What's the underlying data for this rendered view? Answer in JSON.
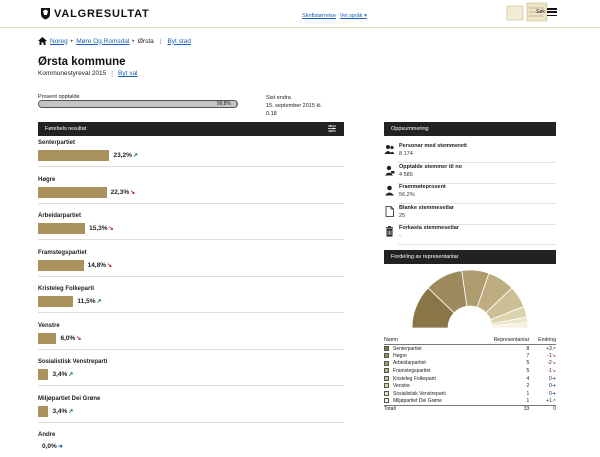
{
  "header": {
    "brand": "VALGRESULTAT",
    "links": [
      "Skriftstørrelse",
      "Vel språk"
    ],
    "menu_label": "Søk"
  },
  "breadcrumb": {
    "items": [
      "Noreg",
      "Møre Og Romsdal",
      "Ørsta"
    ],
    "change_place": "Byt stad"
  },
  "page": {
    "title": "Ørsta kommune",
    "election": "Kommunestyreval 2015",
    "change_election": "Byt val"
  },
  "counted": {
    "label": "Prosent opptalde",
    "percent_text": "99,8%",
    "value": 99.8
  },
  "last_changed": {
    "label": "Sist endra",
    "value_line1": "15. september 2015 kl.",
    "value_line2": "0.18"
  },
  "results": {
    "heading": "Førebels resultat",
    "parties": [
      {
        "name": "Senterpartiet",
        "value": 23.2,
        "text": "23,2%",
        "trend": "up"
      },
      {
        "name": "Høgre",
        "value": 22.3,
        "text": "22,3%",
        "trend": "down"
      },
      {
        "name": "Arbeidarpartiet",
        "value": 15.3,
        "text": "15,3%",
        "trend": "down"
      },
      {
        "name": "Framstegspartiet",
        "value": 14.8,
        "text": "14,8%",
        "trend": "down"
      },
      {
        "name": "Kristeleg Folkeparti",
        "value": 11.5,
        "text": "11,5%",
        "trend": "up"
      },
      {
        "name": "Venstre",
        "value": 6.0,
        "text": "6,0%",
        "trend": "down"
      },
      {
        "name": "Sosialistisk Venstreparti",
        "value": 3.4,
        "text": "3,4%",
        "trend": "up"
      },
      {
        "name": "Miljøpartiet Dei Grøne",
        "value": 3.4,
        "text": "3,4%",
        "trend": "up"
      },
      {
        "name": "Andre",
        "value": 0.0,
        "text": "0,0%",
        "trend": "same"
      }
    ]
  },
  "summary": {
    "heading": "Oppsummering",
    "items": [
      {
        "label": "Personar med stemmerett",
        "value": "8 174",
        "icon": "people-icon"
      },
      {
        "label": "Opptalde stemmer til no",
        "value": "4 585",
        "icon": "person-vote-icon"
      },
      {
        "label": "Frammøteprosent",
        "value": "56,2%",
        "icon": "person-icon"
      },
      {
        "label": "Blanke stemmesetlar",
        "value": "25",
        "icon": "blank-ballot-icon"
      },
      {
        "label": "Forkasta stemmesetlar",
        "value": "-",
        "icon": "trash-icon"
      }
    ]
  },
  "distribution": {
    "heading": "Fordeling av representantar",
    "columns": [
      "Namn",
      "Representantar",
      "Endring"
    ],
    "rows": [
      {
        "name": "Senterpartiet",
        "seats": "8",
        "change": "+3",
        "trend": "up",
        "color": "#8a7546"
      },
      {
        "name": "Høgre",
        "seats": "7",
        "change": "-1",
        "trend": "down",
        "color": "#9c8a5c"
      },
      {
        "name": "Arbeidarpartiet",
        "seats": "5",
        "change": "-2",
        "trend": "down",
        "color": "#ad9c6e"
      },
      {
        "name": "Framstegspartiet",
        "seats": "5",
        "change": "-1",
        "trend": "down",
        "color": "#bdad80"
      },
      {
        "name": "Kristeleg Folkeparti",
        "seats": "4",
        "change": "0",
        "trend": "same",
        "color": "#cdbf95"
      },
      {
        "name": "Venstre",
        "seats": "2",
        "change": "0",
        "trend": "same",
        "color": "#ddd3ad"
      },
      {
        "name": "Sosialistisk Venstreparti",
        "seats": "1",
        "change": "0",
        "trend": "same",
        "color": "#ebe5c8"
      },
      {
        "name": "Miljøpartiet Dei Grøne",
        "seats": "1",
        "change": "+1",
        "trend": "up",
        "color": "#f6f2df"
      }
    ],
    "total_label": "Totalt",
    "total_seats": "33",
    "total_change": "0"
  },
  "colors": {
    "bar": "#a9925e",
    "panel_header": "#222222",
    "link": "#1a5fb4",
    "up": "#0e6d2e",
    "down": "#c01818"
  }
}
